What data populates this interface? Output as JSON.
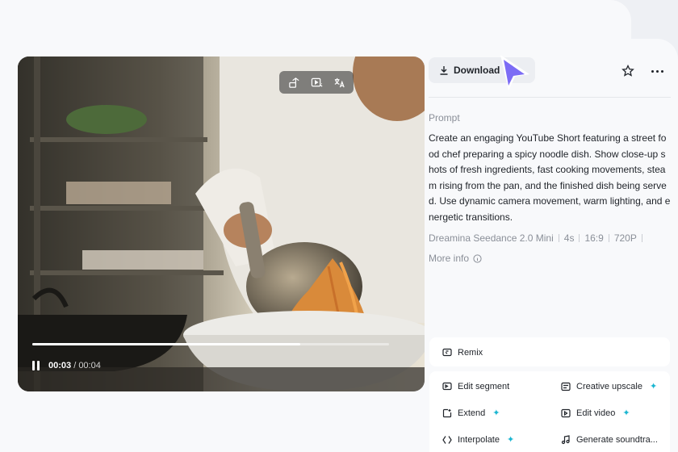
{
  "toolbar": {
    "download_label": "Download"
  },
  "video": {
    "current_time": "00:03",
    "separator": " / ",
    "duration": "00:04",
    "progress": 0.75,
    "tools": [
      "swap-icon",
      "play-magic-icon",
      "translate-icon"
    ]
  },
  "details": {
    "prompt_label": "Prompt",
    "prompt_text": "Create an engaging YouTube Short featuring a street food chef preparing a spicy noodle dish. Show close-up shots of fresh ingredients, fast cooking movements, steam rising from the pan, and the finished dish being served. Use dynamic camera movement, warm lighting, and energetic transitions.",
    "model": "Dreamina Seedance 2.0 Mini",
    "duration": "4s",
    "ratio": "16:9",
    "resolution": "720P",
    "more_info": "More info"
  },
  "actions": {
    "remix": "Remix",
    "edit_segment": "Edit segment",
    "creative_upscale": "Creative upscale",
    "extend": "Extend",
    "edit_video": "Edit video",
    "interpolate": "Interpolate",
    "generate_soundtrack": "Generate soundtra..."
  },
  "colors": {
    "accent_cursor": "#7c6cf5",
    "sparkle": "#1bb6d1"
  }
}
